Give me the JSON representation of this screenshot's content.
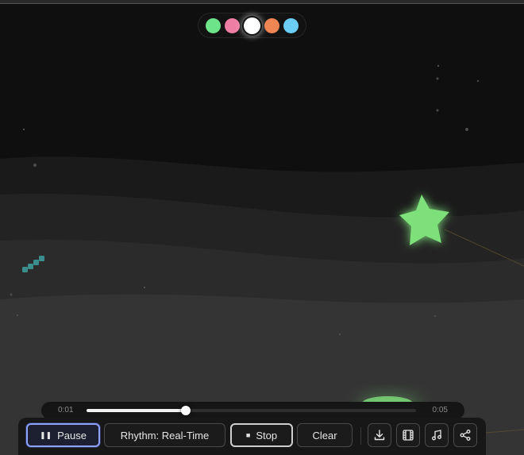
{
  "palette": {
    "swatches": [
      {
        "name": "green",
        "color": "#6ee48a",
        "active": false
      },
      {
        "name": "pink",
        "color": "#ef7ea4",
        "active": false
      },
      {
        "name": "white",
        "color": "#ffffff",
        "active": true
      },
      {
        "name": "orange",
        "color": "#ef8552",
        "active": false
      },
      {
        "name": "blue",
        "color": "#6ccdf4",
        "active": false
      }
    ]
  },
  "timeline": {
    "current_time": "0:01",
    "duration": "0:05",
    "progress": 0.3
  },
  "controls": {
    "pause_label": "Pause",
    "rhythm_label": "Rhythm: Real-Time",
    "stop_label": "Stop",
    "clear_label": "Clear"
  },
  "icons": {
    "download": "download-icon",
    "video": "film-icon",
    "music": "music-note-icon",
    "share": "share-icon"
  },
  "colors": {
    "accent": "#8ea2ff",
    "star": "#7ee07a",
    "background": "#0f0f0f"
  }
}
